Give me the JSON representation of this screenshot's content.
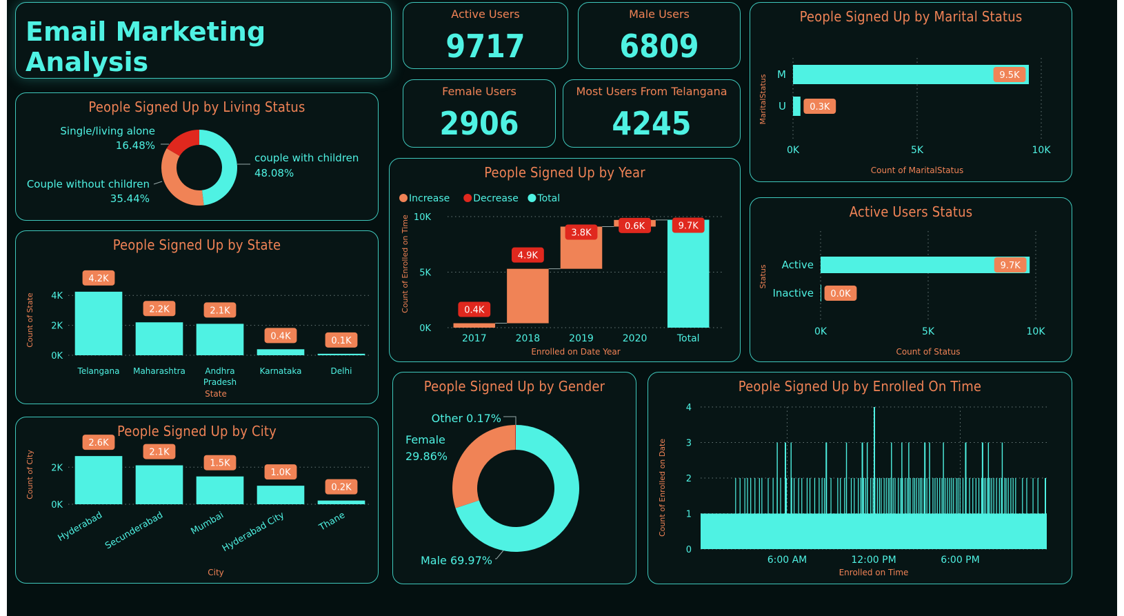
{
  "dashboard": {
    "title": "Email Marketing Analysis",
    "colors": {
      "accent": "#4ff2e3",
      "orange": "#f08356",
      "red": "#e0281e",
      "background": "#041010"
    }
  },
  "kpis": {
    "active_users": {
      "label": "Active Users",
      "value": "9717"
    },
    "male_users": {
      "label": "Male Users",
      "value": "6809"
    },
    "female_users": {
      "label": "Female Users",
      "value": "2906"
    },
    "top_state": {
      "label": "Most Users From Telangana",
      "value": "4245"
    }
  },
  "living_status": {
    "title": "People Signed Up by Living Status",
    "chart_data": {
      "type": "pie",
      "donut": true,
      "slices": [
        {
          "name": "couple with children",
          "percent_label": "48.08%",
          "value": 48.08,
          "color": "#4ff2e3"
        },
        {
          "name": "Couple without children",
          "percent_label": "35.44%",
          "value": 35.44,
          "color": "#f08356"
        },
        {
          "name": "Single/living alone",
          "percent_label": "16.48%",
          "value": 16.48,
          "color": "#e0281e"
        }
      ]
    }
  },
  "state": {
    "title": "People Signed Up by State",
    "chart_data": {
      "type": "bar",
      "categories": [
        "Telangana",
        "Maharashtra",
        "Andhra Pradesh",
        "Karnataka",
        "Delhi"
      ],
      "values": [
        4245,
        2200,
        2100,
        400,
        100
      ],
      "data_labels": [
        "4.2K",
        "2.2K",
        "2.1K",
        "0.4K",
        "0.1K"
      ],
      "xlabel": "State",
      "ylabel": "Count of State",
      "yticks": [
        "0K",
        "2K",
        "4K"
      ],
      "ylim": [
        0,
        4700
      ],
      "grid": true
    }
  },
  "city": {
    "title": "People Signed Up by City",
    "chart_data": {
      "type": "bar",
      "categories": [
        "Hyderabad",
        "Secunderabad",
        "Mumbai",
        "Hyderabad City",
        "Thane"
      ],
      "values": [
        2600,
        2100,
        1500,
        1000,
        200
      ],
      "data_labels": [
        "2.6K",
        "2.1K",
        "1.5K",
        "1.0K",
        "0.2K"
      ],
      "xlabel": "City",
      "ylabel": "Count of City",
      "yticks": [
        "0K",
        "2K"
      ],
      "ylim": [
        0,
        3200
      ],
      "grid": true
    }
  },
  "year": {
    "title": "People Signed Up by Year",
    "legend": [
      "Increase",
      "Decrease",
      "Total"
    ],
    "chart_data": {
      "type": "bar",
      "subtype": "waterfall",
      "categories": [
        "2017",
        "2018",
        "2019",
        "2020",
        "Total"
      ],
      "values": [
        400,
        4900,
        3800,
        600,
        9717
      ],
      "kinds": [
        "increase",
        "increase",
        "increase",
        "increase",
        "total"
      ],
      "data_labels": [
        "0.4K",
        "4.9K",
        "3.8K",
        "0.6K",
        "9.7K"
      ],
      "xlabel": "Enrolled on Date Year",
      "ylabel": "Count of Enrolled on Time",
      "yticks": [
        "0K",
        "5K",
        "10K"
      ],
      "ylim": [
        0,
        10000
      ],
      "legend_position": "top-left",
      "grid": true
    }
  },
  "gender": {
    "title": "People Signed Up by Gender",
    "chart_data": {
      "type": "pie",
      "donut": true,
      "slices": [
        {
          "name": "Male",
          "label": "Male 69.97%",
          "value": 69.97,
          "color": "#4ff2e3"
        },
        {
          "name": "Female",
          "label": "Female",
          "percent_label": "29.86%",
          "value": 29.86,
          "color": "#f08356"
        },
        {
          "name": "Other",
          "label": "Other 0.17%",
          "value": 0.17,
          "color": "#e0281e"
        }
      ]
    }
  },
  "marital": {
    "title": "People Signed Up by Marital Status",
    "chart_data": {
      "type": "bar",
      "orientation": "horizontal",
      "categories": [
        "M",
        "U"
      ],
      "values": [
        9500,
        300
      ],
      "data_labels": [
        "9.5K",
        "0.3K"
      ],
      "xlabel": "Count of MaritalStatus",
      "ylabel": "MaritalStatus",
      "xticks": [
        "0K",
        "5K",
        "10K"
      ],
      "xlim": [
        0,
        10000
      ],
      "grid": true
    }
  },
  "active_status": {
    "title": "Active Users Status",
    "chart_data": {
      "type": "bar",
      "orientation": "horizontal",
      "categories": [
        "Active",
        "Inactive"
      ],
      "values": [
        9717,
        0
      ],
      "data_labels": [
        "9.7K",
        "0.0K"
      ],
      "xlabel": "Count of Status",
      "ylabel": "Status",
      "xticks": [
        "0K",
        "5K",
        "10K"
      ],
      "xlim": [
        0,
        10000
      ],
      "grid": true
    }
  },
  "enrolled_time": {
    "title": "People Signed Up by Enrolled On Time",
    "chart_data": {
      "type": "bar",
      "subtype": "dense-time-histogram",
      "x_range": [
        "0:00",
        "23:59"
      ],
      "xticks": [
        "6:00 AM",
        "12:00 PM",
        "6:00 PM"
      ],
      "yticks": [
        "0",
        "1",
        "2",
        "3",
        "4"
      ],
      "ylim": [
        0,
        4
      ],
      "baseline": 1,
      "peaks": [
        {
          "time": "12:00 PM",
          "value": 4
        },
        {
          "time": "5:50 AM",
          "value": 3
        },
        {
          "time": "8:40 AM",
          "value": 3
        },
        {
          "time": "11:10 AM",
          "value": 3
        },
        {
          "time": "3:30 PM",
          "value": 3
        },
        {
          "time": "6:20 PM",
          "value": 3
        },
        {
          "time": "7:30 PM",
          "value": 3
        }
      ],
      "xlabel": "Enrolled on Time",
      "ylabel": "Count of Enrolled on Date",
      "grid": true
    }
  }
}
